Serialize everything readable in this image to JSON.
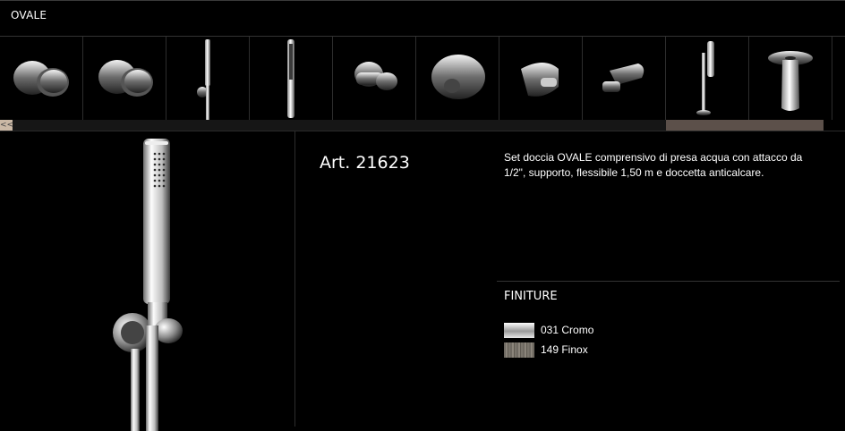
{
  "collection": {
    "title": "OVALE"
  },
  "thumbnails": [
    {
      "label": "",
      "icon": "round-wall-knob-icon"
    },
    {
      "label": "",
      "icon": "round-wall-knob-icon"
    },
    {
      "label": "",
      "icon": "hand-shower-set-icon"
    },
    {
      "label": "",
      "icon": "shower-slide-bar-icon"
    },
    {
      "label": "",
      "icon": "wall-outlet-holder-icon"
    },
    {
      "label": "",
      "icon": "round-wall-outlet-icon"
    },
    {
      "label": "",
      "icon": "shower-holder-icon"
    },
    {
      "label": "",
      "icon": "bracket-outlet-icon"
    },
    {
      "label": "",
      "icon": "shower-column-icon"
    },
    {
      "label": "",
      "icon": "spout-flange-icon"
    }
  ],
  "scrollbar": {
    "left_arrow": "<<"
  },
  "product": {
    "article": "Art. 21623",
    "description": "Set doccia OVALE comprensivo di presa acqua con attacco da 1/2\", supporto, flessibile 1,50 m e doccetta anticalcare.",
    "image_icon": "hand-shower-set-icon"
  },
  "finishes": {
    "heading": "FINITURE",
    "items": [
      {
        "label": "031 Cromo",
        "swatch": "chrome"
      },
      {
        "label": "149 Finox",
        "swatch": "finox"
      }
    ]
  }
}
